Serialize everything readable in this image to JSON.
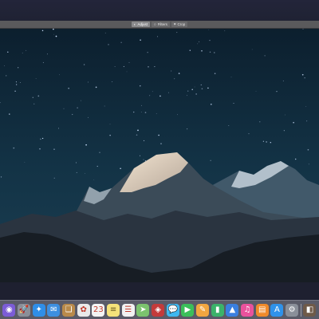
{
  "toolbar": {
    "buttons": [
      {
        "label": "Adjust",
        "icon": "adjust-icon",
        "icon_glyph": "◐",
        "active": true
      },
      {
        "label": "Filters",
        "icon": "filters-icon",
        "icon_glyph": "○"
      },
      {
        "label": "Crop",
        "icon": "crop-icon",
        "icon_glyph": "⌗"
      }
    ]
  },
  "photo": {
    "subject": "mountain range at night under a starry sky"
  },
  "dock": {
    "items": [
      {
        "name": "siri-icon",
        "glyph": "◉",
        "color": "#7b5cd6"
      },
      {
        "name": "launchpad-icon",
        "glyph": "🚀",
        "color": "#8a8f99"
      },
      {
        "name": "safari-icon",
        "glyph": "✦",
        "color": "#2f8ee8"
      },
      {
        "name": "mail-icon",
        "glyph": "✉",
        "color": "#3d8fe0"
      },
      {
        "name": "notes-book-icon",
        "glyph": "❏",
        "color": "#b98a4a"
      },
      {
        "name": "photos-icon",
        "glyph": "✿",
        "color": "#e9e9e9"
      },
      {
        "name": "calendar-icon",
        "glyph": "23",
        "color": "#f4f4f4"
      },
      {
        "name": "notes-icon",
        "glyph": "≡",
        "color": "#f5e27a"
      },
      {
        "name": "reminders-icon",
        "glyph": "☰",
        "color": "#f2f2f2"
      },
      {
        "name": "maps-icon",
        "glyph": "➤",
        "color": "#7cc36e"
      },
      {
        "name": "photo-booth-icon",
        "glyph": "◈",
        "color": "#c33b3b"
      },
      {
        "name": "messages-icon",
        "glyph": "💬",
        "color": "#3fb8f0"
      },
      {
        "name": "facetime-icon",
        "glyph": "▶",
        "color": "#3bbf5a"
      },
      {
        "name": "pages-icon",
        "glyph": "✎",
        "color": "#f2a640"
      },
      {
        "name": "numbers-icon",
        "glyph": "▮",
        "color": "#3bb36a"
      },
      {
        "name": "keynote-icon",
        "glyph": "▲",
        "color": "#3a7fe0"
      },
      {
        "name": "itunes-icon",
        "glyph": "♫",
        "color": "#e9529d"
      },
      {
        "name": "ibooks-icon",
        "glyph": "▤",
        "color": "#f08a2a"
      },
      {
        "name": "app-store-icon",
        "glyph": "A",
        "color": "#2f92ea"
      },
      {
        "name": "system-preferences-icon",
        "glyph": "⚙",
        "color": "#8a8f99"
      },
      {
        "name": "separator"
      },
      {
        "name": "preview-icon",
        "glyph": "◧",
        "color": "#6f5a49"
      }
    ]
  }
}
